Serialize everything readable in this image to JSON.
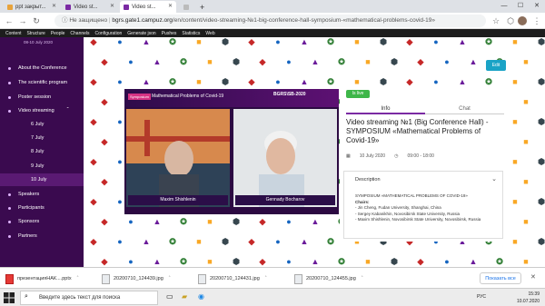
{
  "browser": {
    "tabs": [
      {
        "label": "ррt закрыт..."
      },
      {
        "label": "Video st..."
      },
      {
        "label": "Video st..."
      },
      {
        "label": ""
      }
    ],
    "security_label": "Не защищено",
    "url_host": "bgrs.gate1.campuz.org",
    "url_path": "/en/content/video-streaming-№1-big-conference-hall-symposium-«mathematical-problems-covid-19»"
  },
  "admin_toolbar": {
    "items": [
      "Content",
      "Structure",
      "People",
      "Channels",
      "Configuration",
      "Generate json",
      "Pushes",
      "Statistics",
      "Web"
    ]
  },
  "sidebar": {
    "date_hint": "08-10 July 2020",
    "items": [
      {
        "label": "About the Conference"
      },
      {
        "label": "The scientific program"
      },
      {
        "label": "Poster session"
      },
      {
        "label": "Video streaming"
      },
      {
        "label": "6 July"
      },
      {
        "label": "7 July"
      },
      {
        "label": "8 July"
      },
      {
        "label": "9 July"
      },
      {
        "label": "10 July"
      },
      {
        "label": "Speakers"
      },
      {
        "label": "Participants"
      },
      {
        "label": "Sponsors"
      },
      {
        "label": "Partners"
      }
    ]
  },
  "edit_button": "Edit",
  "video": {
    "slide_badge": "Symposium",
    "slide_title": "Mathematical Problems of Covid-19",
    "conference_title": "BGRS\\SB-2020",
    "left_name": "Maxim Shishlenin",
    "right_name": "Gennady Bocharov"
  },
  "info": {
    "live_badge": "Is live",
    "tab_info": "Info",
    "tab_chat": "Chat",
    "title": "Video streaming №1 (Big Conference Hall) - SYMPOSIUM «Mathematical Problems of Covid-19»",
    "date": "10 July 2020",
    "time": "09:00 - 18:00",
    "description_label": "Description",
    "description_lines": [
      "SYMPOSIUM «MATHEMATICAL PROBLEMS OF COVID-19»",
      "Chairs:",
      "- Jin Cheng, Fudan University, Shanghai, China",
      "- Sergey Kabanikhin, Novosibirsk State University, Russia",
      "- Maxim Shishlenin, Novosibirsk State University, Novosibirsk, Russia"
    ]
  },
  "downloads": [
    {
      "name": "презентацияНАК....pptx"
    },
    {
      "name": "20200710_124439.jpg"
    },
    {
      "name": "20200710_124431.jpg"
    },
    {
      "name": "20200710_124455.jpg"
    }
  ],
  "show_all": "Показать все",
  "taskbar": {
    "search_placeholder": "Введите здесь текст для поиска",
    "lang": "РУС",
    "time": "15:39",
    "date": "10.07.2020"
  },
  "colors": {
    "sidebar_bg": "#3a0a4f",
    "live_green": "#3eb649",
    "accent_purple": "#7b2aa3",
    "edit_blue": "#1aa3c6"
  }
}
